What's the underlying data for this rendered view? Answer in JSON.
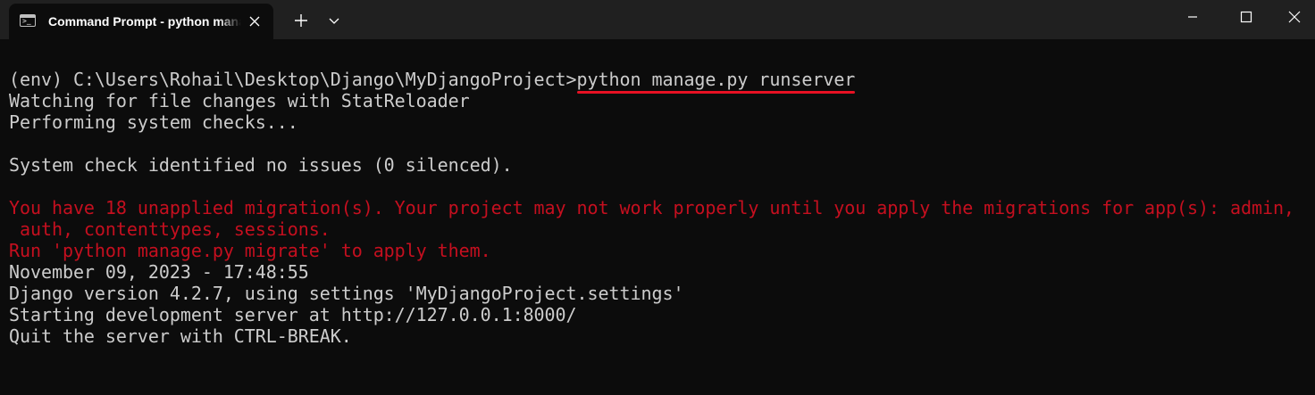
{
  "window": {
    "tab_title": "Command Prompt - python  manage.py  runserver",
    "tab_icon": "terminal-icon",
    "controls": [
      "minimize-icon",
      "maximize-icon",
      "close-icon"
    ]
  },
  "terminal": {
    "prompt": "(env) C:\\Users\\Rohail\\Desktop\\Django\\MyDjangoProject>",
    "command": "python manage.py runserver",
    "lines": [
      "Watching for file changes with StatReloader",
      "Performing system checks...",
      "",
      "System check identified no issues (0 silenced).",
      "",
      "You have 18 unapplied migration(s). Your project may not work properly until you apply the migrations for app(s): admin,",
      " auth, contenttypes, sessions.",
      "Run 'python manage.py migrate' to apply them.",
      "November 09, 2023 - 17:48:55",
      "Django version 4.2.7, using settings 'MyDjangoProject.settings'",
      "Starting development server at http://127.0.0.1:8000/",
      "Quit the server with CTRL-BREAK."
    ]
  },
  "colors": {
    "background": "#0c0c0c",
    "titlebar": "#202020",
    "text": "#cccccc",
    "warning": "#c50f1f",
    "highlight_underline": "#e81123"
  }
}
